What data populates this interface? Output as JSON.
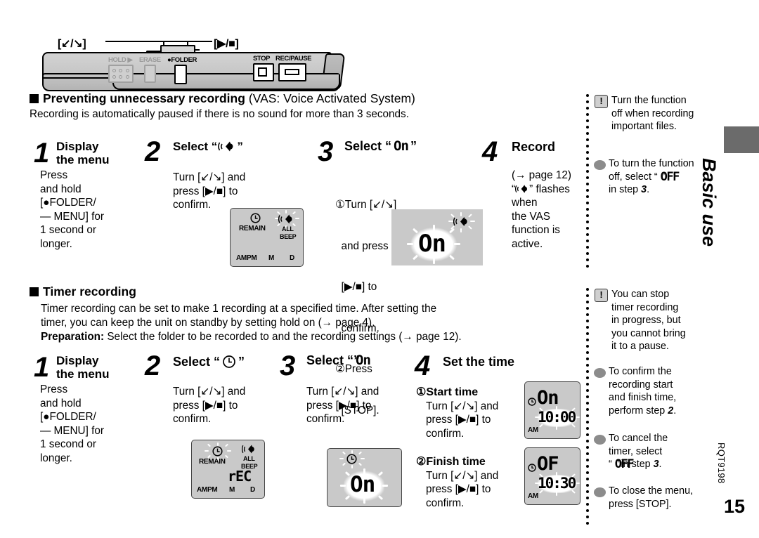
{
  "device": {
    "callout_left": "[↙/↘]",
    "callout_right": "[▶/■]",
    "buttons": [
      {
        "label": "HOLD ▶",
        "name": "hold-switch"
      },
      {
        "label": "ERASE",
        "name": "erase-button"
      },
      {
        "label": "●FOLDER",
        "name": "folder-button"
      },
      {
        "label": "STOP",
        "name": "stop-button"
      },
      {
        "label": "REC/PAUSE",
        "name": "rec-pause-button"
      }
    ]
  },
  "section1": {
    "heading_bold": "Preventing unnecessary recording",
    "heading_normal": "(VAS: Voice Activated System)",
    "body": "Recording is automatically paused if there is no sound for more than 3 seconds.",
    "steps": [
      {
        "num": "1",
        "title_line1": "Display",
        "title_line2": "the menu",
        "body_lines": [
          "Press",
          "and hold",
          "[●FOLDER/",
          "— MENU] for",
          "1 second or",
          "longer."
        ]
      },
      {
        "num": "2",
        "title": "Select “",
        "title_icon": "mic-vas-icon",
        "title_close": "”",
        "body_lines": [
          "Turn [↙/↘] and",
          "press [▶/■] to",
          "confirm."
        ],
        "lcd": {
          "name": "lcd-vas-select",
          "clock_icon": "clock-icon",
          "remain": "REMAIN",
          "vas_icon": "mic-vas-icon",
          "all": "ALL",
          "beep": "BEEP",
          "ampm": "AMPM",
          "m": "M",
          "d": "D",
          "flashing": "vas-icon"
        }
      },
      {
        "num": "3",
        "title": "Select “",
        "title_value": "On",
        "title_close": "”",
        "body_lines": [
          "①Turn [↙/↘]",
          "  and press",
          "  [▶/■] to",
          "  confirm.",
          "②Press",
          "  [STOP]."
        ],
        "lcd": {
          "name": "lcd-vas-on",
          "value": "On",
          "vas_icon": "mic-vas-icon",
          "flashing": "both"
        }
      },
      {
        "num": "4",
        "title": "Record",
        "body_lines": [
          "(→ page 12)",
          "“🔊” flashes",
          "when",
          "the VAS",
          "function is",
          "active."
        ]
      }
    ],
    "notes": [
      {
        "icon": "warning-icon",
        "lines": [
          "Turn the function",
          "off when recording",
          "important files."
        ]
      },
      {
        "icon": "bullet-icon",
        "lines": [
          "To turn the function",
          "off, select “ OFF ”",
          "in step 3."
        ]
      }
    ]
  },
  "section2": {
    "heading": "Timer recording",
    "body_lines": [
      "Timer recording can be set to make 1 recording at a specified time. After setting the",
      "timer, you can keep the unit on standby by setting hold on (→ page 4)."
    ],
    "preparation_label": "Preparation:",
    "preparation_text": " Select the folder to be recorded to and the recording settings (→ page 12).",
    "steps": [
      {
        "num": "1",
        "title_line1": "Display",
        "title_line2": "the menu",
        "body_lines": [
          "Press",
          "and hold",
          "[●FOLDER/",
          "— MENU] for",
          "1 second or",
          "longer."
        ]
      },
      {
        "num": "2",
        "title": "Select “",
        "title_icon": "clock-icon",
        "title_close": "”",
        "body_lines": [
          "Turn [↙/↘] and",
          "press [▶/■] to",
          "confirm."
        ],
        "lcd": {
          "name": "lcd-timer-select",
          "clock_icon": "clock-icon",
          "remain": "REMAIN",
          "vas_icon": "mic-vas-icon",
          "all": "ALL",
          "beep": "BEEP",
          "value": "rEC",
          "ampm": "AMPM",
          "m": "M",
          "d": "D",
          "flashing": "clock-icon"
        }
      },
      {
        "num": "3",
        "title": "Select “",
        "title_value": "On",
        "title_close": "”",
        "body_lines": [
          "Turn [↙/↘] and",
          "press [▶/■] to",
          "confirm."
        ],
        "lcd": {
          "name": "lcd-timer-on",
          "clock_icon": "clock-icon",
          "value": "On",
          "flashing": "both"
        }
      },
      {
        "num": "4",
        "title": "Set the time",
        "sub1_label": "①Start time",
        "sub1_lines": [
          "Turn [↙/↘] and",
          "press [▶/■] to",
          "confirm."
        ],
        "sub2_label": "②Finish time",
        "sub2_lines": [
          "Turn [↙/↘] and",
          "press [▶/■] to",
          "confirm."
        ],
        "lcd_start": {
          "name": "lcd-start-time",
          "mode": "On",
          "time": "10:00",
          "ampm": "AM",
          "clock_icon": "clock-icon"
        },
        "lcd_finish": {
          "name": "lcd-finish-time",
          "mode": "OF",
          "time": "10:30",
          "ampm": "AM",
          "clock_icon": "clock-icon"
        }
      }
    ],
    "notes": [
      {
        "icon": "warning-icon",
        "lines": [
          "You can stop",
          "timer recording",
          "in progress, but",
          "you cannot bring",
          "it to a pause."
        ]
      },
      {
        "icon": "bullet-icon",
        "lines": [
          "To confirm the",
          "recording start",
          "and finish time,",
          "perform step 2."
        ]
      },
      {
        "icon": "bullet-icon",
        "lines": [
          "To cancel the",
          "timer, select",
          "“ OFF ”in step 3."
        ]
      },
      {
        "icon": "bullet-icon",
        "lines": [
          "To close the menu,",
          "press [STOP]."
        ]
      }
    ]
  },
  "sidebar": {
    "tab_label": "Basic use",
    "doc_code": "RQT9198",
    "page_number": "15"
  },
  "colors": {
    "lcd_bg": "#c9c9c9",
    "tab_grey": "#6b6b6b",
    "note_bullet": "#8c8c8c",
    "device_grey": "#c9c9c9"
  }
}
